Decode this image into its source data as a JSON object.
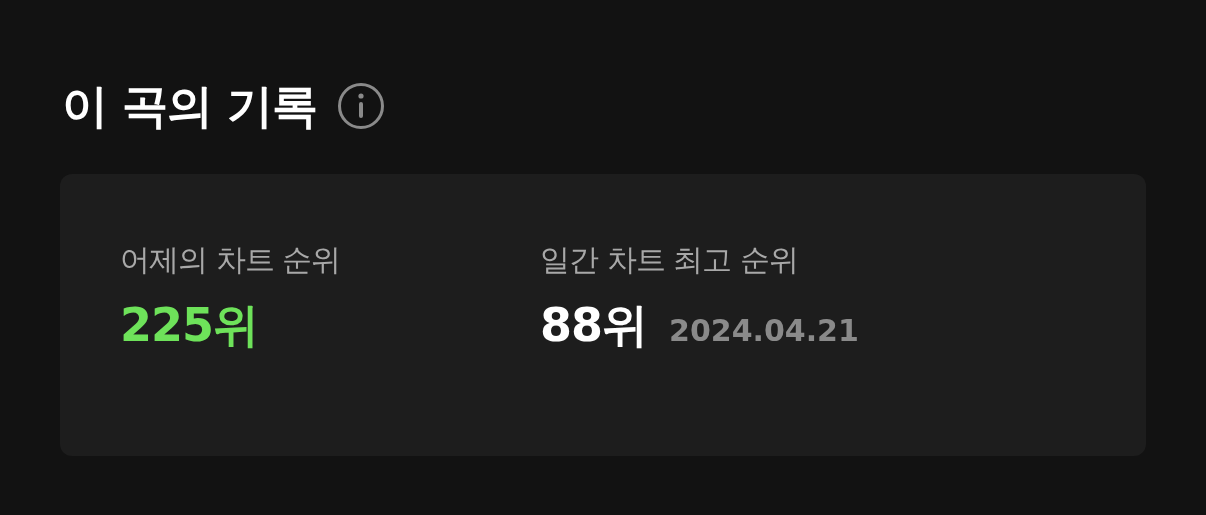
{
  "section": {
    "title": "이 곡의 기록"
  },
  "stats": [
    {
      "label": "어제의 차트 순위",
      "value": "225위",
      "color": "#6ee25a"
    },
    {
      "label": "일간 차트 최고 순위",
      "value": "88위",
      "color": "#ffffff",
      "date": "2024.04.21"
    }
  ]
}
